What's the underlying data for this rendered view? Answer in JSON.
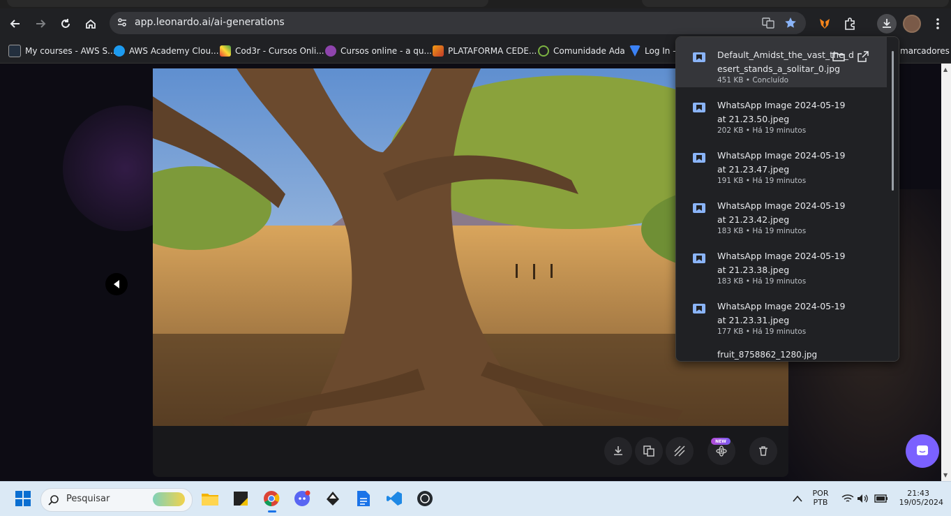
{
  "browser": {
    "url": "app.leonardo.ai/ai-generations",
    "bookmarks": [
      {
        "label": "My courses - AWS S..."
      },
      {
        "label": "AWS Academy Clou..."
      },
      {
        "label": "Cod3r - Cursos Onli..."
      },
      {
        "label": "Cursos online - a qu..."
      },
      {
        "label": "PLATAFORMA CEDE..."
      },
      {
        "label": "Comunidade Ada"
      },
      {
        "label": "Log In -"
      }
    ],
    "bookmarks_overflow": "marcadores"
  },
  "downloads": {
    "items": [
      {
        "name": "Default_Amidst_the_vast_the_desert_stands_a_solitar_0.jpg",
        "meta": "451 KB • Concluído"
      },
      {
        "name": "WhatsApp Image 2024-05-19 at 21.23.50.jpeg",
        "meta": "202 KB • Há 19 minutos"
      },
      {
        "name": "WhatsApp Image 2024-05-19 at 21.23.47.jpeg",
        "meta": "191 KB • Há 19 minutos"
      },
      {
        "name": "WhatsApp Image 2024-05-19 at 21.23.42.jpeg",
        "meta": "183 KB • Há 19 minutos"
      },
      {
        "name": "WhatsApp Image 2024-05-19 at 21.23.38.jpeg",
        "meta": "183 KB • Há 19 minutos"
      },
      {
        "name": "WhatsApp Image 2024-05-19 at 21.23.31.jpeg",
        "meta": "177 KB • Há 19 minutos"
      }
    ],
    "cut_item": "fruit_8758862_1280.jpg"
  },
  "viewer": {
    "new_badge": "NEW"
  },
  "taskbar": {
    "search_placeholder": "Pesquisar",
    "lang_top": "POR",
    "lang_bottom": "PTB",
    "time": "21:43",
    "date": "19/05/2024"
  },
  "colors": {
    "accent": "#8ab4f8",
    "chat": "#7b61ff"
  }
}
